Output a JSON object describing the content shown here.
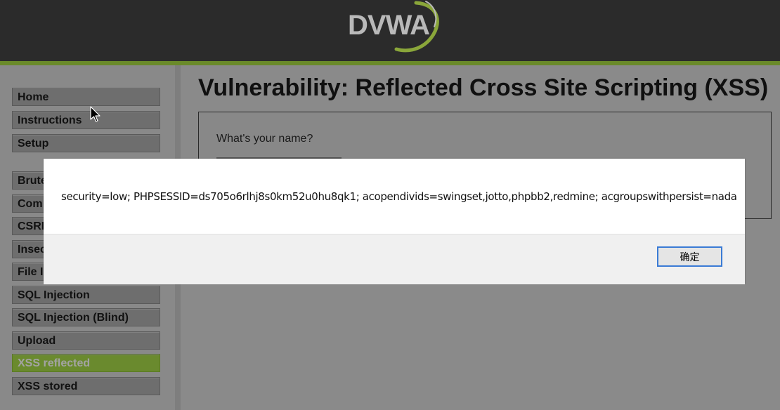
{
  "header": {
    "logo_text": "DVWA"
  },
  "sidebar": {
    "items": [
      {
        "label": "Home"
      },
      {
        "label": "Instructions"
      },
      {
        "label": "Setup"
      },
      {
        "label": "Brute"
      },
      {
        "label": "Com"
      },
      {
        "label": "CSRF"
      },
      {
        "label": "Insec"
      },
      {
        "label": "File I"
      },
      {
        "label": "SQL Injection"
      },
      {
        "label": "SQL Injection (Blind)"
      },
      {
        "label": "Upload"
      },
      {
        "label": "XSS reflected"
      },
      {
        "label": "XSS stored"
      }
    ],
    "active_item": "XSS reflected"
  },
  "main": {
    "title": "Vulnerability: Reflected Cross Site Scripting (XSS)",
    "form": {
      "name_label": "What's your name?"
    }
  },
  "dialog": {
    "message": "security=low; PHPSESSID=ds705o6rlhj8s0km52u0hu8qk1; acopendivids=swingset,jotto,phpbb2,redmine; acgroupswithpersist=nada",
    "ok_label": "确定"
  },
  "colors": {
    "header_bg": "#2b2b2b",
    "accent_green": "#6a8a2a",
    "page_bg": "#8a8a8a",
    "focus_blue": "#3a7bd5"
  }
}
